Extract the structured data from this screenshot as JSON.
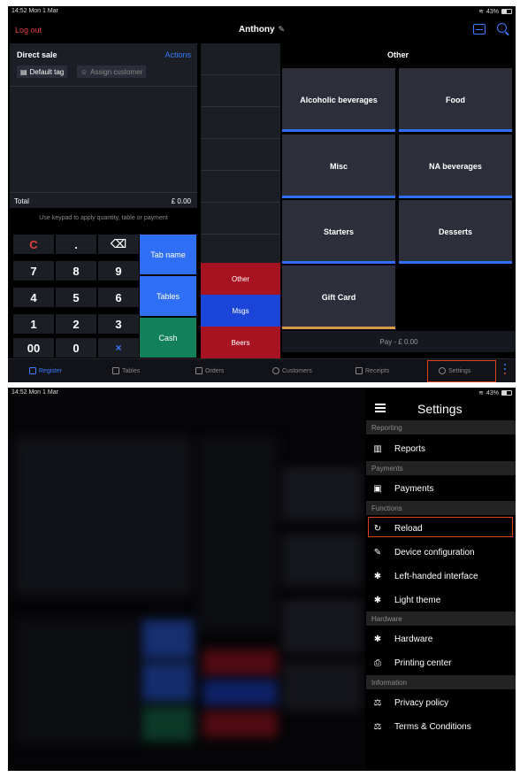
{
  "status_bar": {
    "time": "14:52  Mon 1 Mar",
    "battery": "43%"
  },
  "topbar": {
    "logout": "Log out",
    "user": "Anthony",
    "user_icon": "edit-icon",
    "scan_icon": "barcode-scan-icon",
    "search_icon": "search-icon"
  },
  "sale": {
    "title": "Direct sale",
    "actions": "Actions",
    "default_tag": "Default tag",
    "assign_customer": "Assign customer",
    "total_label": "Total",
    "total_value": "£ 0.00",
    "hint": "Use keypad to apply quantity, table or payment"
  },
  "keypad": {
    "keys": [
      "C",
      ".",
      "⌫",
      "7",
      "8",
      "9",
      "4",
      "5",
      "6",
      "1",
      "2",
      "3",
      "00",
      "0",
      "×"
    ],
    "tab_name": "Tab name",
    "tables": "Tables",
    "cash": "Cash"
  },
  "middle": {
    "other": "Other",
    "msgs": "Msgs",
    "beers": "Beers"
  },
  "categories": {
    "header": "Other",
    "items": [
      "Alcoholic beverages",
      "Food",
      "Misc",
      "NA beverages",
      "Starters",
      "Desserts",
      "Gift Card"
    ],
    "pay": "Pay - £ 0.00"
  },
  "nav": {
    "register": "Register",
    "tables": "Tables",
    "orders": "Orders",
    "customers": "Customers",
    "receipts": "Receipts",
    "settings": "Settings"
  },
  "settings_menu": {
    "title": "Settings",
    "sections": {
      "reporting": "Reporting",
      "payments": "Payments",
      "functions": "Functions",
      "hardware": "Hardware",
      "information": "Information"
    },
    "items": {
      "reports": "Reports",
      "payments": "Payments",
      "reload": "Reload",
      "device_configuration": "Device configuration",
      "left_handed": "Left-handed interface",
      "light_theme": "Light theme",
      "hardware": "Hardware",
      "printing_center": "Printing center",
      "privacy_policy": "Privacy policy",
      "terms": "Terms & Conditions"
    }
  },
  "colors": {
    "accent": "#3a7bff",
    "danger": "#e04040",
    "highlight": "#e0421e",
    "cash": "#12805a",
    "red_button": "#a81322",
    "gift_bar": "#d79a4a"
  }
}
